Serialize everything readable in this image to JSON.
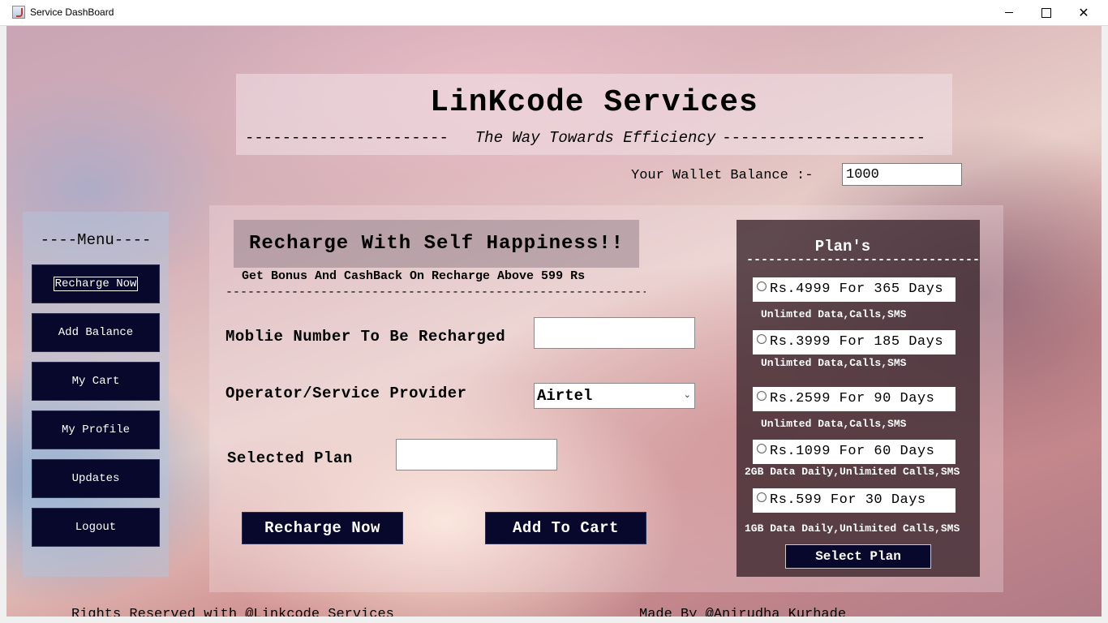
{
  "window": {
    "title": "Service DashBoard",
    "icons": [
      "java-app-icon",
      "minimize-icon",
      "maximize-icon",
      "close-icon"
    ]
  },
  "header": {
    "title": "LinKcode Services",
    "tagline_dashes_left": "----------------------",
    "tagline": "The Way Towards Efficiency",
    "tagline_dashes_right": "----------------------"
  },
  "wallet": {
    "label": "Your Wallet Balance :-",
    "value": "1000"
  },
  "menu": {
    "title": "----Menu----",
    "items": [
      {
        "label": "Recharge Now"
      },
      {
        "label": "Add Balance"
      },
      {
        "label": "My Cart"
      },
      {
        "label": "My Profile"
      },
      {
        "label": "Updates"
      },
      {
        "label": "Logout"
      }
    ]
  },
  "recharge": {
    "heading": "Recharge With Self Happiness!!",
    "bonus": "Get Bonus And CashBack On Recharge Above 599 Rs",
    "separator": "-------------------------------------------------------------------",
    "mobile_label": "Moblie Number To Be Recharged",
    "mobile_value": "",
    "operator_label": "Operator/Service Provider",
    "operator_selected": "Airtel",
    "plan_label": "Selected Plan",
    "plan_value": "",
    "recharge_button": "Recharge Now",
    "cart_button": "Add To Cart"
  },
  "plans": {
    "title": "Plan's",
    "separator": "-------------------------------------",
    "items": [
      {
        "label": "Rs.4999 For 365 Days",
        "desc": "Unlimted Data,Calls,SMS"
      },
      {
        "label": "Rs.3999 For 185 Days",
        "desc": "Unlimted Data,Calls,SMS"
      },
      {
        "label": "Rs.2599 For 90 Days",
        "desc": "Unlimted Data,Calls,SMS"
      },
      {
        "label": "Rs.1099 For 60 Days",
        "desc": "2GB Data Daily,Unlimited Calls,SMS"
      },
      {
        "label": "Rs.599 For 30 Days",
        "desc": "1GB Data Daily,Unlimited Calls,SMS"
      }
    ],
    "select_button": "Select Plan"
  },
  "footer": {
    "left": "Rights Reserved with @Linkcode Services",
    "right": "Made By @Anirudha Kurhade"
  }
}
